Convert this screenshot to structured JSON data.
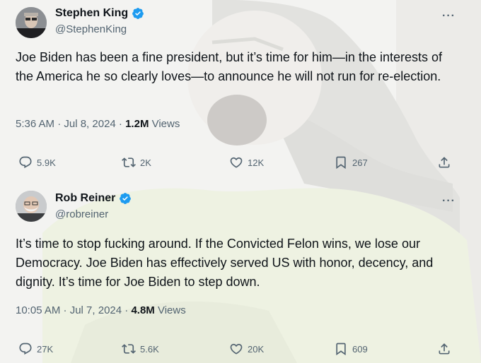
{
  "tweets": [
    {
      "name": "Stephen King",
      "handle": "@StephenKing",
      "text": "Joe Biden has been a fine president, but it’s time for him—in the interests of the America he so clearly loves—to announce he will not run for re-election.",
      "time": "5:36 AM · Jul 8, 2024 · ",
      "views_count": "1.2M",
      "views_label": " Views",
      "replies": "5.9K",
      "reposts": "2K",
      "likes": "12K",
      "bookmarks": "267"
    },
    {
      "name": "Rob Reiner",
      "handle": "@robreiner",
      "text": "It’s time to stop fucking around. If the Convicted Felon wins, we lose our Democracy. Joe Biden has effectively served US with honor, decency, and dignity. It’s time for Joe Biden to step down.",
      "time": "10:05 AM · Jul 7, 2024 · ",
      "views_count": "4.8M",
      "views_label": " Views",
      "replies": "27K",
      "reposts": "5.6K",
      "likes": "20K",
      "bookmarks": "609"
    }
  ],
  "more_label": "···",
  "colors": {
    "verified": "#1d9bf0",
    "text": "#0f1419",
    "muted": "#536471"
  }
}
